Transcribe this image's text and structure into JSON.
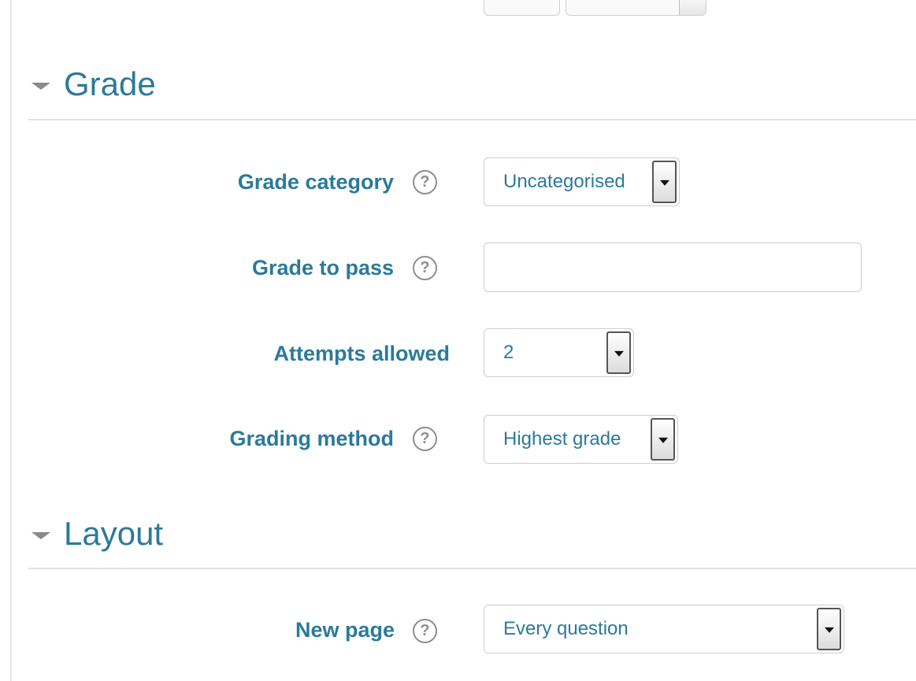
{
  "sections": {
    "grade": {
      "title": "Grade",
      "fields": {
        "grade_category": {
          "label": "Grade category",
          "value": "Uncategorised"
        },
        "grade_to_pass": {
          "label": "Grade to pass",
          "value": ""
        },
        "attempts_allowed": {
          "label": "Attempts allowed",
          "value": "2"
        },
        "grading_method": {
          "label": "Grading method",
          "value": "Highest grade"
        }
      }
    },
    "layout": {
      "title": "Layout",
      "fields": {
        "new_page": {
          "label": "New page",
          "value": "Every question"
        }
      }
    }
  },
  "icons": {
    "help": "question-circle-icon",
    "collapse": "caret-down-icon",
    "dropdown": "chevron-down-icon"
  },
  "colors": {
    "accent": "#2b7a9a",
    "icon_gray": "#8f8f8f",
    "divider": "#e2e2e2"
  }
}
